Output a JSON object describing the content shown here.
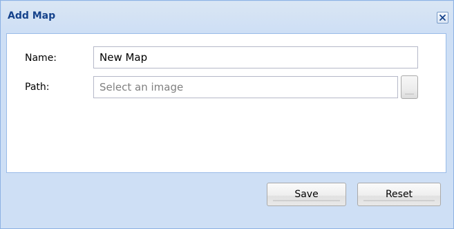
{
  "dialog": {
    "title": "Add Map",
    "close_icon": "close-icon"
  },
  "form": {
    "name_label": "Name:",
    "name_value": "New Map",
    "path_label": "Path:",
    "path_placeholder": "Select an image",
    "path_value": ""
  },
  "buttons": {
    "save_label": "Save",
    "reset_label": "Reset"
  },
  "colors": {
    "title": "#15428b",
    "frame": "#cedff5",
    "border": "#99bbe8"
  }
}
